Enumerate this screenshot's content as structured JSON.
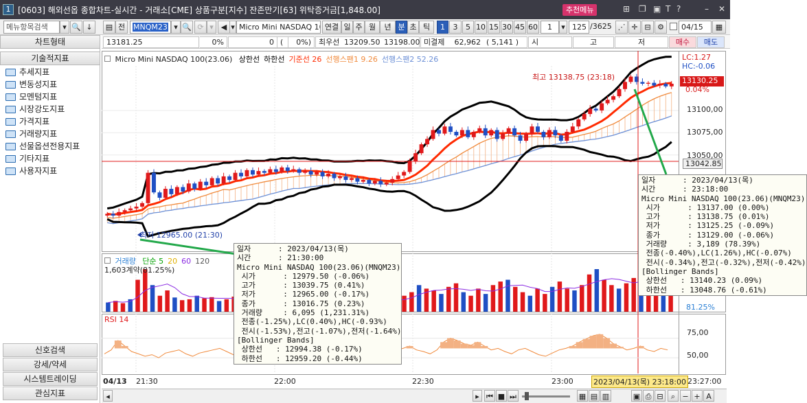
{
  "window": {
    "number": "1",
    "title": "[0603] 해외선옵 종합차트-실시간 - 거래소[CME] 상품구분[지수] 잔존만기[63] 위탁증거금[1,848.00]",
    "recommend_menu": "추천메뉴",
    "icons": [
      "grid-icon",
      "copy-icon",
      "restore-icon",
      "font-icon",
      "help-icon",
      "minimize-icon",
      "close-icon"
    ]
  },
  "toolbar": {
    "menu_search_placeholder": "메뉴항목검색",
    "full_label": "전",
    "symbol_code": "MNQM23",
    "symbol_name": "Micro Mini NASDAQ 100",
    "period_buttons": [
      "연결",
      "일",
      "주",
      "월",
      "년",
      "분",
      "초",
      "틱"
    ],
    "selected_period": "분",
    "interval_buttons": [
      "1",
      "3",
      "5",
      "10",
      "15",
      "30",
      "45",
      "60"
    ],
    "selected_interval": "1",
    "interval_value": "1",
    "count_display": "125",
    "count_total": "/3625",
    "date_value": "04/15"
  },
  "quote_bar": {
    "price": "13181.25",
    "change_pct": "0%",
    "volume": "0",
    "change2": "(",
    "change2_pct": "0%)",
    "best_bid_label": "최우선",
    "best_bid": "13209.50",
    "best_ask": "13198.00",
    "open_interest_label": "미결제",
    "open_interest": "62,962",
    "oi_change": "( 5,141 )",
    "market_labels": [
      "시",
      "고",
      "저"
    ],
    "buy_button": "매수",
    "sell_button": "매도"
  },
  "left_panel": {
    "tabs": [
      "차트형태",
      "기술적지표"
    ],
    "items": [
      "추세지표",
      "변동성지표",
      "모멘텀지표",
      "시장강도지표",
      "가격지표",
      "거래량지표",
      "선물옵션전용지표",
      "기타지표",
      "사용자지표"
    ],
    "bottom_buttons": [
      "신호검색",
      "강세/약세",
      "시스템트레이딩",
      "관심지표"
    ]
  },
  "chart_data": [
    {
      "type": "candlestick",
      "title": "Micro Mini NASDAQ 100(23.06)",
      "legend": [
        {
          "name": "상한선",
          "color": "#000000"
        },
        {
          "name": "하한선",
          "color": "#000000"
        },
        {
          "name": "기준선 26",
          "color": "#ff2a00"
        },
        {
          "name": "선행스팬1 9.26",
          "color": "#f08a3c"
        },
        {
          "name": "선행스팬2 52.26",
          "color": "#6b8fd6"
        }
      ],
      "x_ticks": [
        "04/13",
        "21:30",
        "22:00",
        "22:30",
        "23:00",
        "23:27:00"
      ],
      "y_ticks": [
        13100.0,
        13075.0,
        13050.0
      ],
      "y_range": [
        12945,
        13150
      ],
      "current_price_label": "13130.25",
      "current_change": "0.04%",
      "crosshair_value": "13042.85",
      "crosshair_date": "2023/04/13(목) 23:18:00",
      "lc_label": "LC:1.27",
      "hc_label": "HC:-0.06",
      "high_note": "최고 13138.75 (23:18)",
      "low_note": "최저 12965.00 (21:30)",
      "close": [
        12984,
        12982,
        12986,
        12988,
        12990,
        12992,
        12996,
        13030,
        13008,
        13002,
        13012,
        13006,
        13014,
        13009,
        13018,
        13012,
        13020,
        13016,
        13024,
        13018,
        13026,
        13022,
        13030,
        13026,
        13033,
        13028,
        13032,
        13030,
        13034,
        13031,
        13036,
        13032,
        13034,
        13030,
        13032,
        13028,
        13031,
        13026,
        13029,
        13024,
        13026,
        13022,
        13024,
        13020,
        13022,
        13018,
        13021,
        13017,
        13019,
        13023,
        13027,
        13031,
        13043,
        13052,
        13062,
        13068,
        13078,
        13074,
        13082,
        13076,
        13072,
        13078,
        13070,
        13076,
        13080,
        13072,
        13078,
        13068,
        13074,
        13080,
        13072,
        13066,
        13074,
        13082,
        13076,
        13070,
        13078,
        13072,
        13066,
        13076,
        13082,
        13090,
        13096,
        13102,
        13100,
        13108,
        13112,
        13116,
        13124,
        13132,
        13138,
        13132,
        13130,
        13131,
        13128,
        13130,
        13127,
        13130
      ]
    },
    {
      "type": "bar",
      "title": "거래량",
      "legend": [
        {
          "name": "단순 5",
          "color": "#00a000"
        },
        {
          "name": "20",
          "color": "#e0b000"
        },
        {
          "name": "60",
          "color": "#8a2be2"
        },
        {
          "name": "120",
          "color": "#555555"
        }
      ],
      "subtitle": "1,603계약(81.25%)",
      "current_label": "81.25%",
      "values": [
        520,
        610,
        480,
        700,
        1800,
        2400,
        1500,
        900,
        1200,
        800,
        650,
        700,
        900,
        760,
        820,
        600,
        700,
        850,
        640,
        760,
        900,
        700,
        680,
        620,
        580,
        750,
        900,
        820,
        700,
        650,
        720,
        600,
        640,
        560,
        700,
        820,
        600,
        560,
        640,
        700,
        900,
        1100,
        1500,
        1300,
        1200,
        1000,
        1400,
        1600,
        1100,
        900,
        1300,
        1000,
        1500,
        1700,
        1800,
        1400,
        1100,
        900,
        1300,
        1000,
        1400,
        1700,
        1300,
        1200,
        1500,
        2100,
        2400,
        1800,
        1500,
        1300,
        1600,
        1900,
        2200,
        1700,
        1500,
        2000,
        1600
      ]
    },
    {
      "type": "line",
      "title": "RSI 14",
      "y_ticks": [
        75.0,
        50.0
      ],
      "y_range": [
        30,
        100
      ],
      "values": [
        55,
        60,
        72,
        65,
        58,
        55,
        52,
        54,
        50,
        56,
        58,
        60,
        55,
        52,
        56,
        58,
        60,
        62,
        58,
        54,
        52,
        50,
        54,
        58,
        60,
        57,
        53,
        50,
        48,
        52,
        55,
        58,
        60,
        57,
        54,
        56,
        58,
        60,
        62,
        58,
        55,
        53,
        57,
        60,
        62,
        65,
        60,
        58,
        55,
        60,
        70,
        75,
        72,
        68,
        66,
        70,
        65,
        60,
        62,
        58,
        55,
        60,
        62,
        58,
        54,
        52,
        56,
        60,
        62,
        65,
        70,
        74,
        78,
        80,
        75,
        68,
        64,
        60,
        62,
        65,
        60,
        58,
        62,
        60
      ]
    }
  ],
  "tooltips": [
    {
      "date_label": "일자",
      "date": "2023/04/13(목)",
      "time_label": "시간",
      "time": "21:30:00",
      "symbol": "Micro Mini NASDAQ 100(23.06)(MNQM23)",
      "rows": [
        {
          "k": "시가",
          "v": "12979.50 (-0.06%)"
        },
        {
          "k": "고가",
          "v": "13039.75 (0.41%)"
        },
        {
          "k": "저가",
          "v": "12965.00 (-0.17%)"
        },
        {
          "k": "종가",
          "v": "13016.75 (0.23%)"
        },
        {
          "k": "거래량",
          "v": "6,095 (1,231.31%)"
        }
      ],
      "line1": "전종(-1.25%),LC(0.40%),HC(-0.93%)",
      "line2": "전시(-1.53%),전고(-1.07%),전저(-1.64%)",
      "bands_title": "[Bollinger Bands]",
      "upper": "12994.38 (-0.17%)",
      "lower": "12959.20 (-0.44%)",
      "upper_label": "상한선",
      "lower_label": "하한선"
    },
    {
      "date_label": "일자",
      "date": "2023/04/13(목)",
      "time_label": "시간",
      "time": "23:18:00",
      "symbol": "Micro Mini NASDAQ 100(23.06)(MNQM23)",
      "rows": [
        {
          "k": "시가",
          "v": "13137.00 (0.00%)"
        },
        {
          "k": "고가",
          "v": "13138.75 (0.01%)"
        },
        {
          "k": "저가",
          "v": "13125.25 (-0.09%)"
        },
        {
          "k": "종가",
          "v": "13129.00 (-0.06%)"
        },
        {
          "k": "거래량",
          "v": "3,189 (78.39%)"
        }
      ],
      "line1": "전종(-0.40%),LC(1.26%),HC(-0.07%)",
      "line2": "전시(-0.34%),전고(-0.32%),전저(-0.42%)",
      "bands_title": "[Bollinger Bands]",
      "upper": "13140.23 (0.09%)",
      "lower": "13048.76 (-0.61%)",
      "upper_label": "상한선",
      "lower_label": "하한선"
    }
  ],
  "colors": {
    "up": "#e0191b",
    "down": "#1f4fc4",
    "kijun": "#ff2a00",
    "span1": "#f08a3c",
    "span2": "#6b8fd6",
    "band": "#000000",
    "crosshair": "#e01818",
    "annotation": "#22a84a"
  }
}
